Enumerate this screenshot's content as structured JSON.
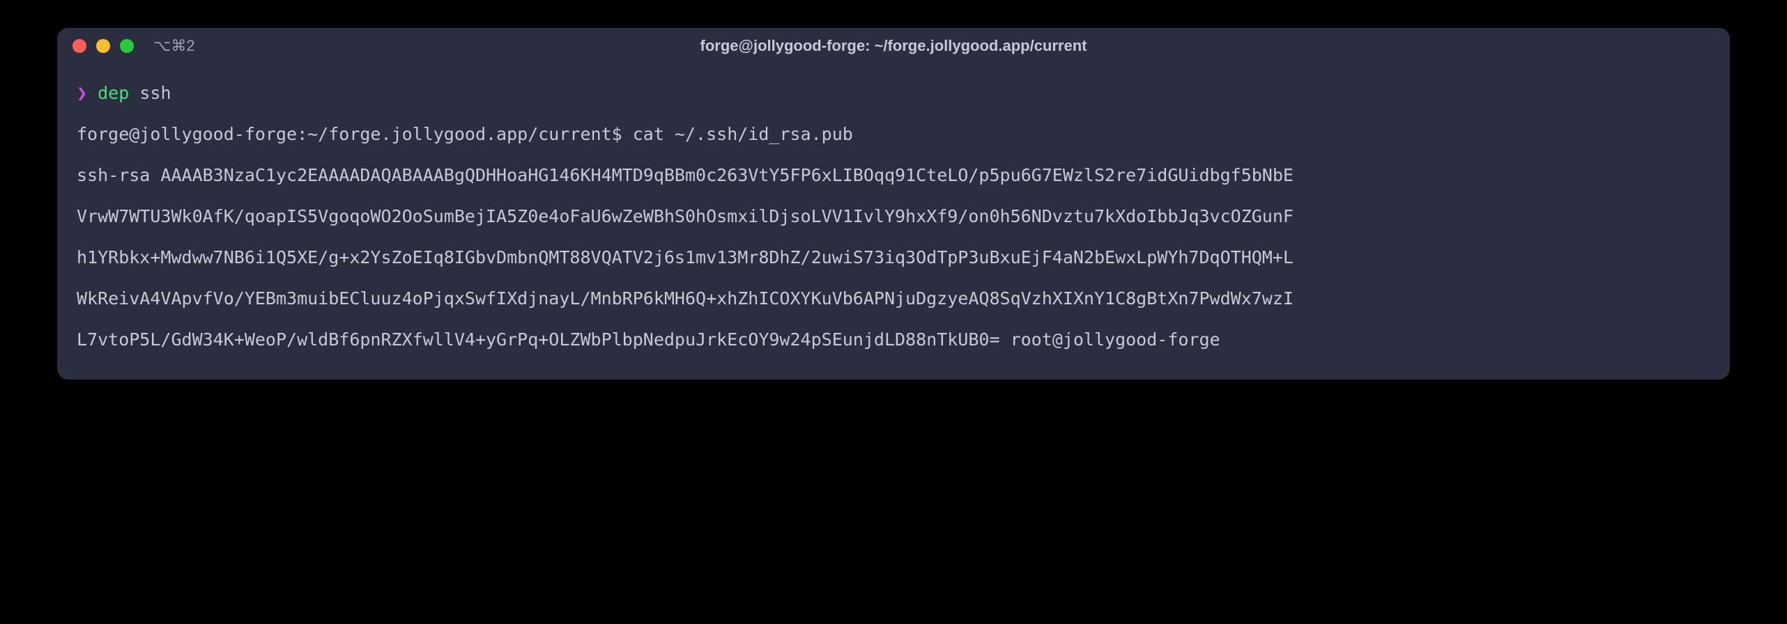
{
  "titlebar": {
    "tab_label": "⌥⌘2",
    "window_title": "forge@jollygood-forge: ~/forge.jollygood.app/current"
  },
  "prompt": {
    "symbol": "❯",
    "command": "dep",
    "arg": "ssh"
  },
  "shell": {
    "prompt_prefix": "forge@jollygood-forge:~/forge.jollygood.app/current$",
    "command": "cat ~/.ssh/id_rsa.pub"
  },
  "output": {
    "line1": "ssh-rsa AAAAB3NzaC1yc2EAAAADAQABAAABgQDHHoaHG146KH4MTD9qBBm0c263VtY5FP6xLIBOqq91CteLO/p5pu6G7EWzlS2re7idGUidbgf5bNbE",
    "line2": "VrwW7WTU3Wk0AfK/qoapIS5VgoqoWO2OoSumBejIA5Z0e4oFaU6wZeWBhS0hOsmxilDjsoLVV1IvlY9hxXf9/on0h56NDvztu7kXdoIbbJq3vcOZGunF",
    "line3": "h1YRbkx+Mwdww7NB6i1Q5XE/g+x2YsZoEIq8IGbvDmbnQMT88VQATV2j6s1mv13Mr8DhZ/2uwiS73iq3OdTpP3uBxuEjF4aN2bEwxLpWYh7DqOTHQM+L",
    "line4": "WkReivA4VApvfVo/YEBm3muibECluuz4oPjqxSwfIXdjnayL/MnbRP6kMH6Q+xhZhICOXYKuVb6APNjuDgzyeAQ8SqVzhXIXnY1C8gBtXn7PwdWx7wzI",
    "line5": "L7vtoP5L/GdW34K+WeoP/wldBf6pnRZXfwllV4+yGrPq+OLZWbPlbpNedpuJrkEcOY9w24pSEunjdLD88nTkUB0= root@jollygood-forge"
  }
}
